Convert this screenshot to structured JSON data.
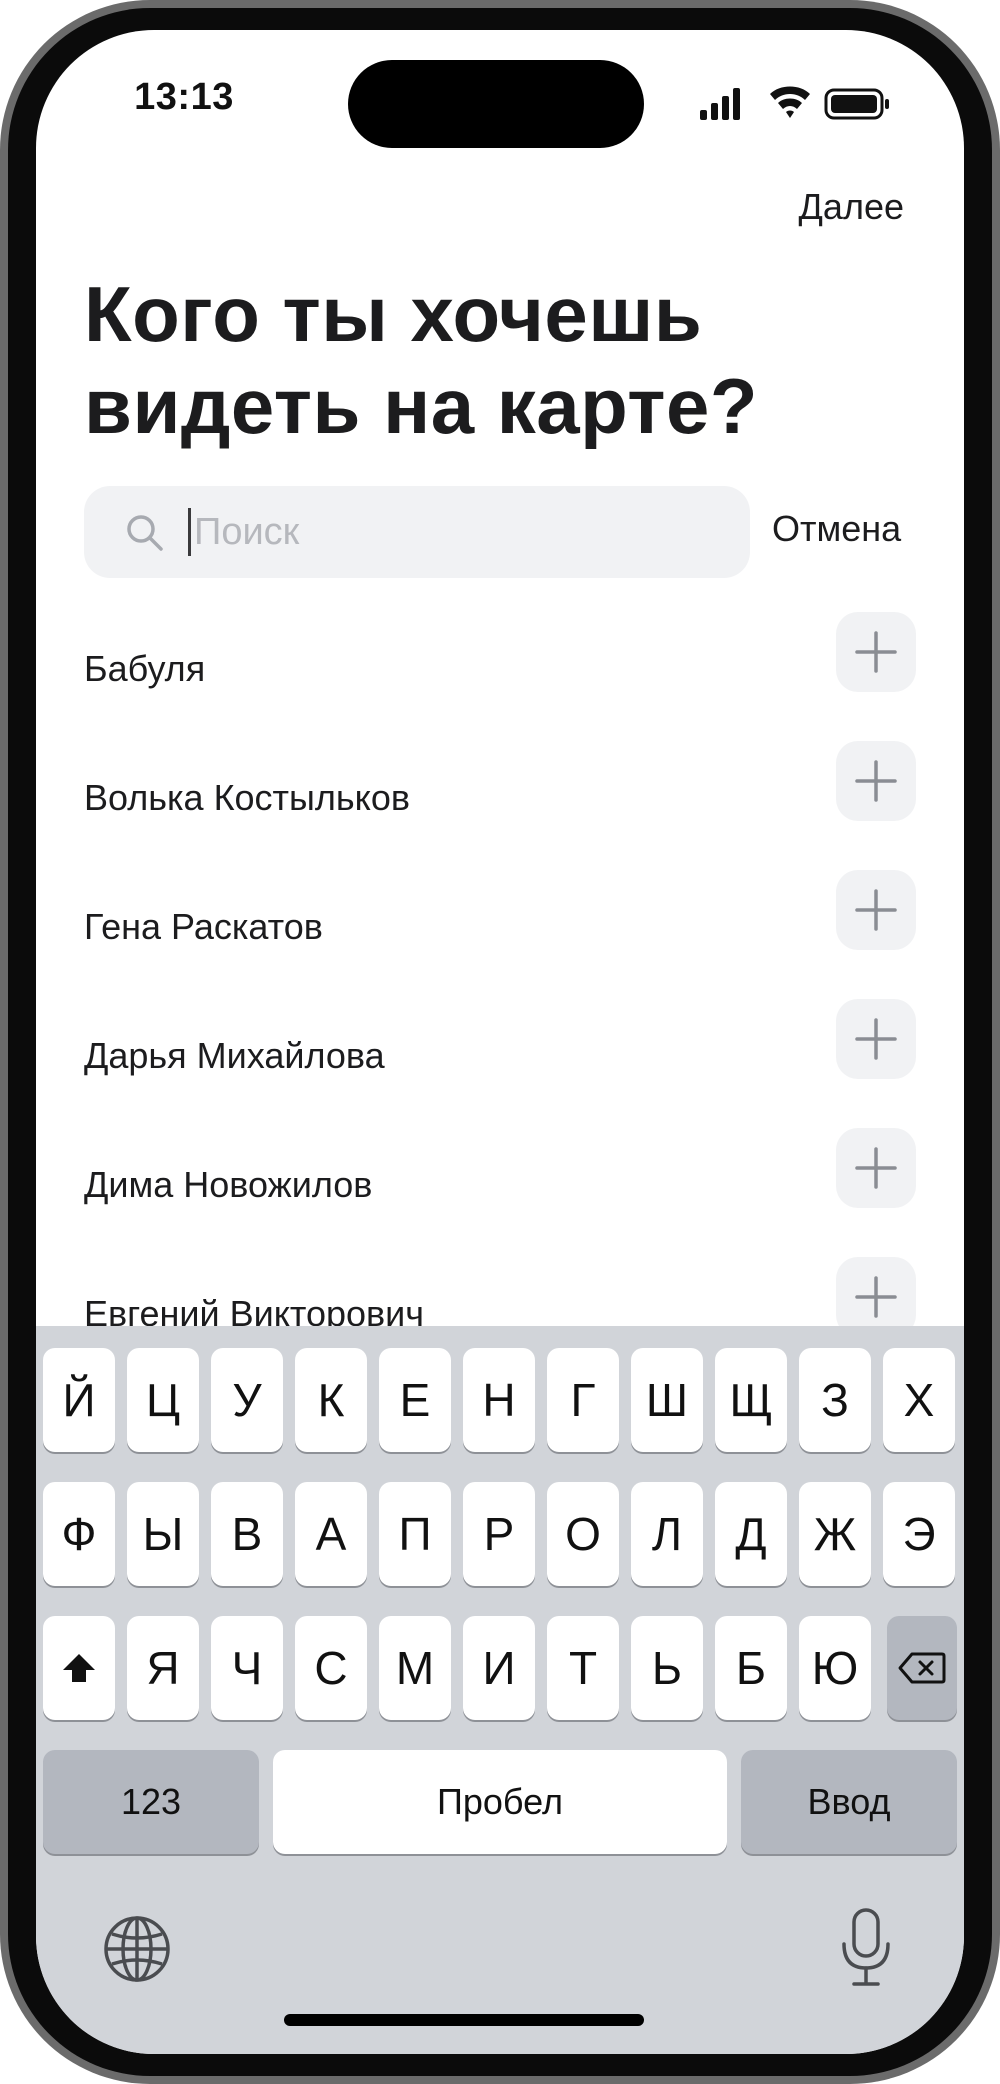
{
  "status_bar": {
    "time": "13:13"
  },
  "header": {
    "next_label": "Далее"
  },
  "title": {
    "line1": "Кого ты хочешь",
    "line2": "видеть на карте?"
  },
  "search": {
    "placeholder": "Поиск",
    "value": "",
    "cancel_label": "Отмена"
  },
  "contacts": [
    {
      "name": "Бабуля"
    },
    {
      "name": "Волька Костыльков"
    },
    {
      "name": "Гена Раскатов"
    },
    {
      "name": "Дарья Михайлова"
    },
    {
      "name": "Дима Новожилов"
    },
    {
      "name": "Евгений Викторович"
    }
  ],
  "keyboard": {
    "row1": [
      "Й",
      "Ц",
      "У",
      "К",
      "Е",
      "Н",
      "Г",
      "Ш",
      "Щ",
      "З",
      "Х"
    ],
    "row2": [
      "Ф",
      "Ы",
      "В",
      "А",
      "П",
      "Р",
      "О",
      "Л",
      "Д",
      "Ж",
      "Э"
    ],
    "row3": [
      "Я",
      "Ч",
      "С",
      "М",
      "И",
      "Т",
      "Ь",
      "Б",
      "Ю"
    ],
    "numbers_label": "123",
    "space_label": "Пробел",
    "return_label": "Ввод"
  },
  "icons": {
    "search": "search-icon",
    "add": "plus-icon",
    "shift": "shift-icon",
    "backspace": "backspace-icon",
    "globe": "globe-icon",
    "mic": "microphone-icon",
    "signal": "cellular-signal-icon",
    "wifi": "wifi-icon",
    "battery": "battery-icon"
  },
  "colors": {
    "text": "#1c1c1e",
    "field_bg": "#f1f2f4",
    "keyboard_bg": "#d1d4d9",
    "key_bg": "#ffffff",
    "key_dark_bg": "#b3b7bf"
  }
}
